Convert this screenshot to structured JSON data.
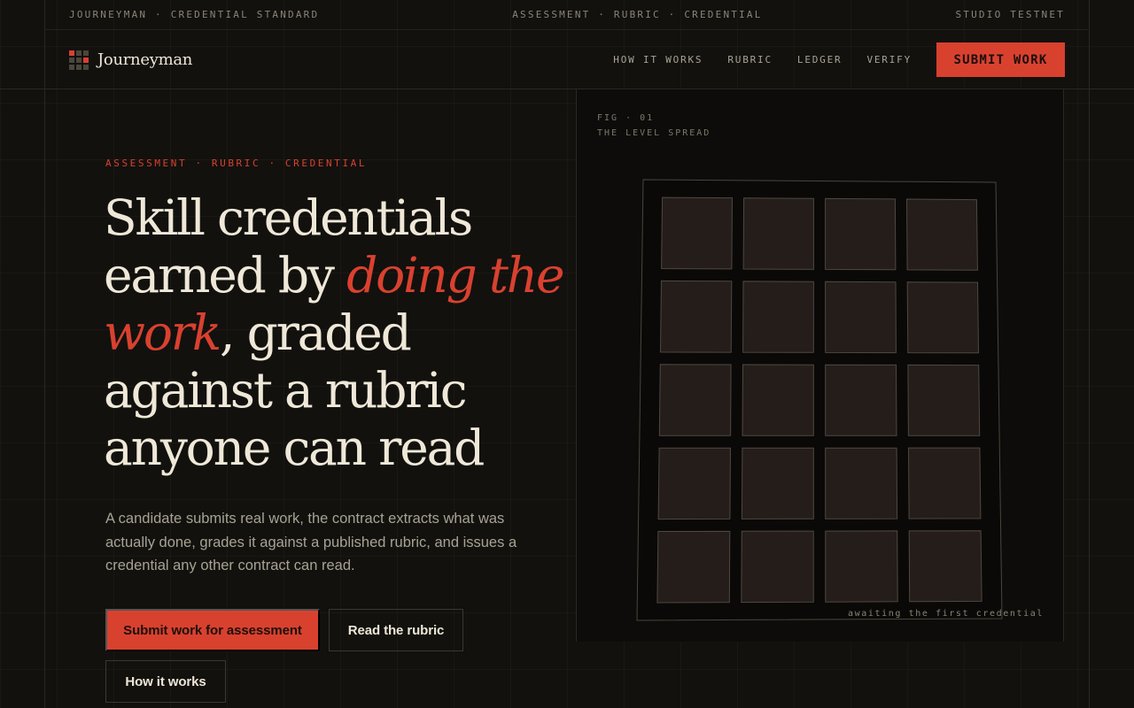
{
  "topbar": {
    "left": "JOURNEYMAN · CREDENTIAL STANDARD",
    "center": "ASSESSMENT · RUBRIC · CREDENTIAL",
    "right": "STUDIO TESTNET"
  },
  "nav": {
    "brand": "Journeyman",
    "links": [
      "HOW IT WORKS",
      "RUBRIC",
      "LEDGER",
      "VERIFY"
    ],
    "cta": "SUBMIT WORK"
  },
  "hero": {
    "eyebrow": "ASSESSMENT · RUBRIC · CREDENTIAL",
    "headline_a": "Skill credentials earned by ",
    "headline_em": "doing the work",
    "headline_b": ", graded against a rubric anyone can read",
    "lede": "A candidate submits real work, the contract extracts what was actually done, grades it against a published rubric, and issues a credential any other contract can read.",
    "primary_cta": "Submit work for assessment",
    "secondary_cta": "Read the rubric",
    "tertiary_cta": "How it works"
  },
  "figure": {
    "label_line1": "FIG · 01",
    "label_line2": "THE LEVEL SPREAD",
    "caption": "awaiting the first credential"
  },
  "colors": {
    "accent": "#d9412f",
    "background": "#12110e",
    "panel": "#0d0c0a",
    "tile": "#241d1a"
  },
  "icons": {
    "brand": "brand-grid-icon"
  }
}
